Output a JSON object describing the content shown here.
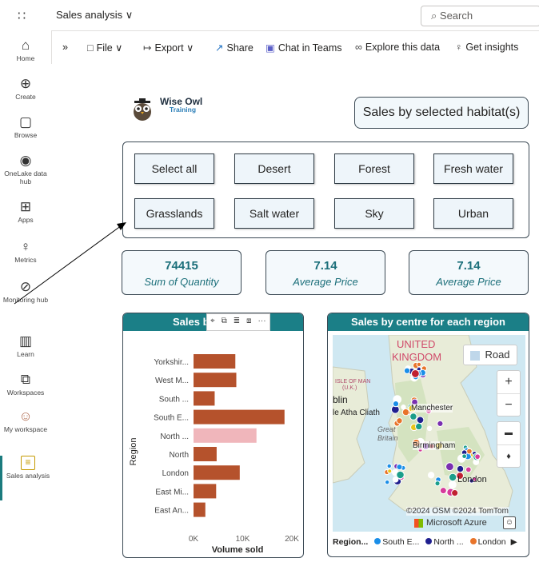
{
  "topbar": {
    "waffle": "∷",
    "breadcrumb": "Sales analysis ∨",
    "search_placeholder": "Search"
  },
  "sidebar": {
    "items": [
      {
        "label": "Home",
        "icon": "⌂"
      },
      {
        "label": "Create",
        "icon": "⊕"
      },
      {
        "label": "Browse",
        "icon": "▢"
      },
      {
        "label": "OneLake data hub",
        "icon": "◉"
      },
      {
        "label": "Apps",
        "icon": "⊞"
      },
      {
        "label": "Metrics",
        "icon": "♀"
      },
      {
        "label": "Monitoring hub",
        "icon": "⊘"
      },
      {
        "label": "Learn",
        "icon": "▥"
      },
      {
        "label": "Workspaces",
        "icon": "⧉"
      },
      {
        "label": "My workspace",
        "icon": "☺"
      },
      {
        "label": "Sales analysis",
        "icon": "≡"
      }
    ]
  },
  "toolbar": {
    "expand": "»",
    "file": "File ∨",
    "export": "Export ∨",
    "share": "Share",
    "chat": "Chat in Teams",
    "explore": "Explore this data",
    "insights": "Get insights"
  },
  "logo": {
    "line1": "Wise Owl",
    "line2": "Training"
  },
  "report_title": "Sales by selected habitat(s)",
  "habitat_buttons": [
    "Select all",
    "Desert",
    "Forest",
    "Fresh water",
    "Grasslands",
    "Salt water",
    "Sky",
    "Urban"
  ],
  "cards": [
    {
      "value": "74415",
      "label": "Sum of Quantity"
    },
    {
      "value": "7.14",
      "label": "Average Price"
    },
    {
      "value": "7.14",
      "label": "Average Price"
    }
  ],
  "bar_visual": {
    "title": "Sales b",
    "header_icons": [
      "pin-icon",
      "copy-icon",
      "filter-icon",
      "focus-icon",
      "more-icon"
    ],
    "header_glyphs": [
      "⌖",
      "⧉",
      "≣",
      "⧈",
      "···"
    ]
  },
  "chart_data": {
    "type": "bar",
    "orientation": "horizontal",
    "categories": [
      "Yorkshir...",
      "West M...",
      "South ...",
      "South E...",
      "North ...",
      "North",
      "London",
      "East Mi...",
      "East An..."
    ],
    "values": [
      8500,
      8700,
      4300,
      18500,
      12800,
      4700,
      9400,
      4600,
      2400
    ],
    "highlighted_index": 4,
    "bar_color": "#b5522c",
    "highlight_color": "#f0b6bb",
    "xlabel": "Volume sold",
    "ylabel": "Region",
    "xticks": [
      "0K",
      "10K",
      "20K"
    ],
    "xlim": [
      0,
      20000
    ]
  },
  "map_visual": {
    "title": "Sales by centre for each region",
    "labels": {
      "country1": "UNITED",
      "country2": "KINGDOM",
      "iom": "ISLE OF MAN",
      "iom2": "(U.K.)",
      "dublin": "blin",
      "irish": "le Atha Cliath",
      "manchester": "Manchester",
      "great": "Great",
      "britain": "Britain",
      "birmingham": "Birmingham",
      "london": "London"
    },
    "road_button": "Road",
    "zoom_in": "+",
    "zoom_out": "−",
    "copyright": "©2024 OSM ©2024 TomTom",
    "provider": "Microsoft Azure",
    "legend_title": "Region...",
    "legend_items": [
      {
        "label": "South E...",
        "color": "#1a8ee8"
      },
      {
        "label": "North ...",
        "color": "#1f1f8f"
      },
      {
        "label": "London",
        "color": "#e8742a"
      }
    ],
    "legend_more": "▶"
  }
}
